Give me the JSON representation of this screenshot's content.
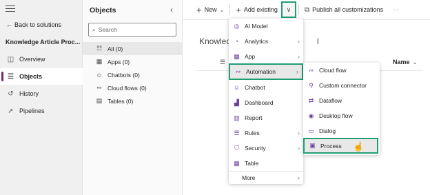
{
  "leftnav": {
    "back_label": "Back to solutions",
    "solution_title": "Knowledge Article Proc...",
    "items": [
      {
        "label": "Overview"
      },
      {
        "label": "Objects"
      },
      {
        "label": "History"
      },
      {
        "label": "Pipelines"
      }
    ]
  },
  "objects": {
    "title": "Objects",
    "search_placeholder": "Search",
    "items": [
      {
        "label": "All  (0)"
      },
      {
        "label": "Apps  (0)"
      },
      {
        "label": "Chatbots  (0)"
      },
      {
        "label": "Cloud flows  (0)"
      },
      {
        "label": "Tables  (0)"
      }
    ]
  },
  "toolbar": {
    "new_label": "New",
    "add_existing_label": "Add existing",
    "publish_label": "Publish all customizations",
    "more_label": "···"
  },
  "main": {
    "heading_start": "Knowled",
    "heading_end": "l",
    "column_name": "Name"
  },
  "add_menu": {
    "items": [
      {
        "label": "AI Model"
      },
      {
        "label": "Analytics"
      },
      {
        "label": "App"
      },
      {
        "label": "Automation"
      },
      {
        "label": "Chatbot"
      },
      {
        "label": "Dashboard"
      },
      {
        "label": "Report"
      },
      {
        "label": "Rules"
      },
      {
        "label": "Security"
      },
      {
        "label": "Table"
      },
      {
        "label": "More"
      }
    ]
  },
  "automation_menu": {
    "items": [
      {
        "label": "Cloud flow"
      },
      {
        "label": "Custom connector"
      },
      {
        "label": "Dataflow"
      },
      {
        "label": "Desktop flow"
      },
      {
        "label": "Dialog"
      },
      {
        "label": "Process"
      }
    ]
  },
  "colors": {
    "accent": "#742774",
    "highlight_border": "#1f9e74",
    "menu_icon": "#6b3fa0"
  }
}
